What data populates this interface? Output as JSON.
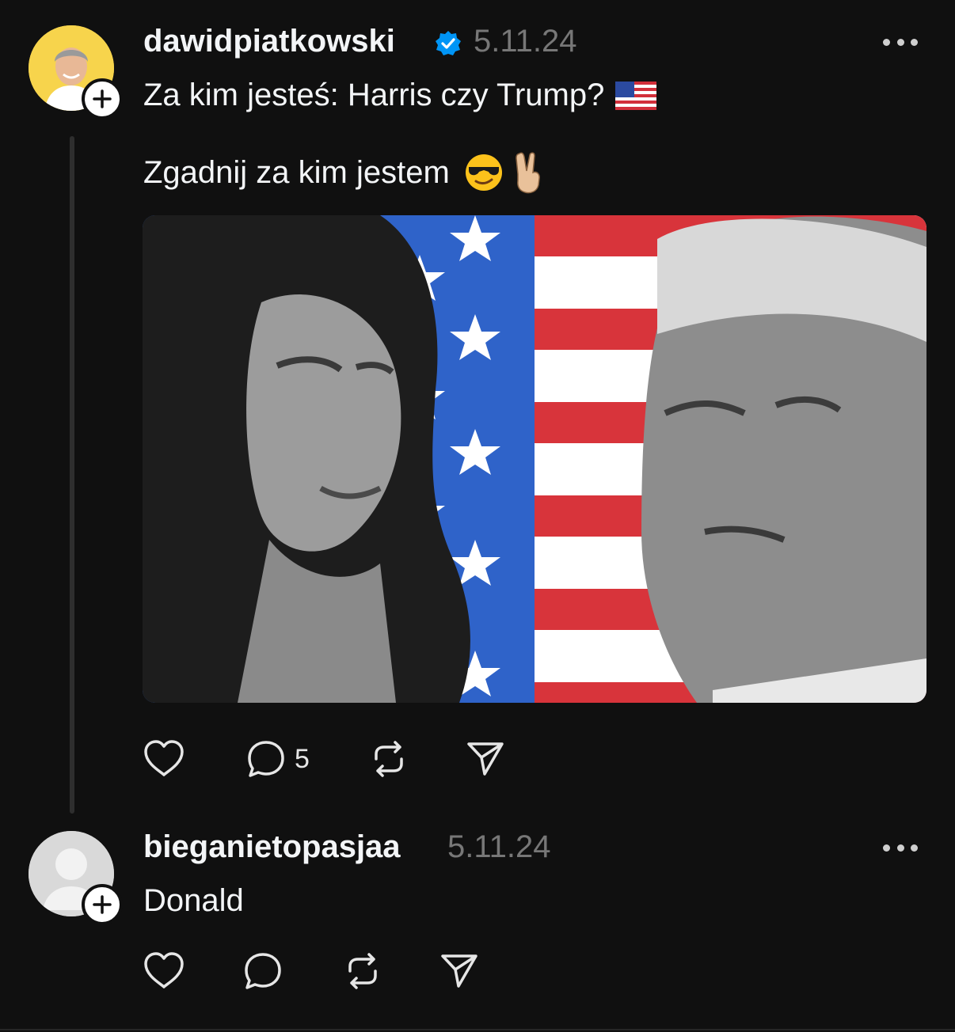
{
  "post": {
    "username": "dawidpiatkowski",
    "verified": true,
    "date": "5.11.24",
    "line1": "Za kim jesteś: Harris czy Trump?",
    "line1_emoji": "us-flag",
    "line2": "Zgadnij za kim jestem",
    "line2_emojis": [
      "smiling-face-with-sunglasses",
      "victory-hand"
    ],
    "image_subject": "Harris and Trump portraits with US flag",
    "reply_count": "5"
  },
  "reply": {
    "username": "bieganietopasjaa",
    "date": "5.11.24",
    "text": "Donald"
  },
  "colors": {
    "background": "#101010",
    "verified_badge": "#0095f6",
    "avatar_bg": "#f7d44c",
    "secondary_text": "#777777"
  }
}
